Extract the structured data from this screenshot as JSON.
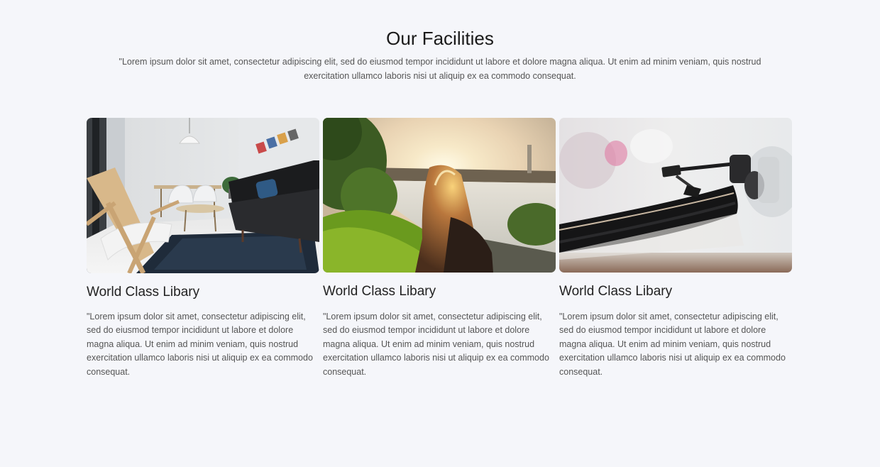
{
  "section": {
    "title": "Our Facilities",
    "intro": "\"Lorem ipsum dolor sit amet, consectetur adipiscing elit, sed do eiusmod tempor incididunt ut labore et dolore magna aliqua. Ut enim ad minim veniam, quis nostrud exercitation ullamco laboris nisi ut aliquip ex ea commodo consequat."
  },
  "cards": [
    {
      "image": "living-room-photo",
      "title": "World Class Libary",
      "text": "\"Lorem ipsum dolor sit amet, consectetur adipiscing elit, sed do eiusmod tempor incididunt ut labore et dolore magna aliqua. Ut enim ad minim veniam, quis nostrud exercitation ullamco laboris nisi ut aliquip ex ea commodo consequat."
    },
    {
      "image": "sunset-girl-photo",
      "title": "World Class Libary",
      "text": "\"Lorem ipsum dolor sit amet, consectetur adipiscing elit, sed do eiusmod tempor incididunt ut labore et dolore magna aliqua. Ut enim ad minim veniam, quis nostrud exercitation ullamco laboris nisi ut aliquip ex ea commodo consequat."
    },
    {
      "image": "record-player-photo",
      "title": "World Class Libary",
      "text": "\"Lorem ipsum dolor sit amet, consectetur adipiscing elit, sed do eiusmod tempor incididunt ut labore et dolore magna aliqua. Ut enim ad minim veniam, quis nostrud exercitation ullamco laboris nisi ut aliquip ex ea commodo consequat."
    }
  ],
  "colors": {
    "background": "#f5f6fa",
    "heading": "#1a1a1a",
    "body_text": "#555555"
  }
}
